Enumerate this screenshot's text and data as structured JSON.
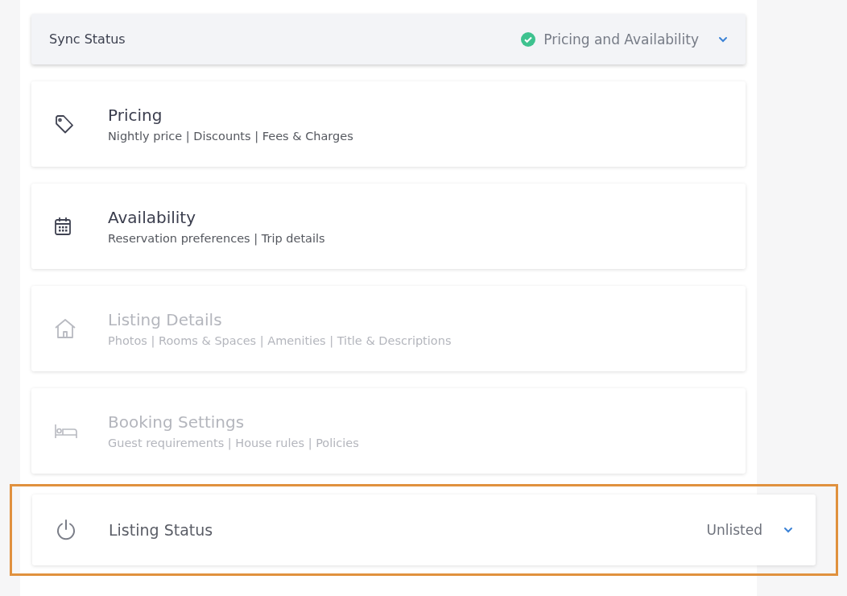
{
  "sync_status": {
    "label": "Sync Status",
    "value": "Pricing and Availability",
    "synced": true
  },
  "sections": [
    {
      "title": "Pricing",
      "subtitle": "Nightly price | Discounts | Fees & Charges",
      "disabled": false
    },
    {
      "title": "Availability",
      "subtitle": "Reservation preferences | Trip details",
      "disabled": false
    },
    {
      "title": "Listing Details",
      "subtitle": "Photos | Rooms & Spaces | Amenities | Title & Descriptions",
      "disabled": true
    },
    {
      "title": "Booking Settings",
      "subtitle": "Guest requirements | House rules | Policies",
      "disabled": true
    }
  ],
  "listing_status": {
    "label": "Listing Status",
    "value": "Unlisted",
    "highlighted": true
  }
}
